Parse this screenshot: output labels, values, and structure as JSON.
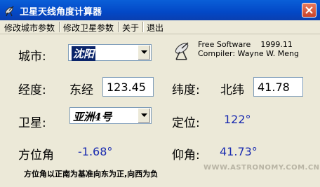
{
  "window": {
    "title": "卫星天线角度计算器"
  },
  "menu": {
    "items": [
      "修改城市参数",
      "修改卫星参数",
      "关于",
      "退出"
    ]
  },
  "info": {
    "line1_label": "Free Software",
    "line1_version": "1999.11",
    "line2": "Compiler: Wayne W. Meng"
  },
  "city": {
    "label": "城市:",
    "selected": "沈阳"
  },
  "longitude": {
    "label": "经度:",
    "direction": "东经",
    "value": "123.45"
  },
  "latitude": {
    "label": "纬度:",
    "direction": "北纬",
    "value": "41.78"
  },
  "satellite": {
    "label": "卫星:",
    "selected": "亚洲4号"
  },
  "position": {
    "label": "定位:",
    "value": "122°"
  },
  "azimuth": {
    "label": "方位角",
    "value": "-1.68°"
  },
  "elevation": {
    "label": "仰角:",
    "value": "41.73°"
  },
  "footer": {
    "note": "方位角以正南为基准向东为正,向西为负"
  },
  "watermark": "WWW.ASTRONOMY.COM.CN",
  "colors": {
    "titlebar": "#0348c6",
    "value_blue": "#1a2bb0",
    "selection": "#0a246a"
  },
  "icons": {
    "app": "satellite-dish-icon",
    "close": "close-icon",
    "info": "satellite-dish-icon",
    "dropdown": "chevron-down-icon"
  }
}
